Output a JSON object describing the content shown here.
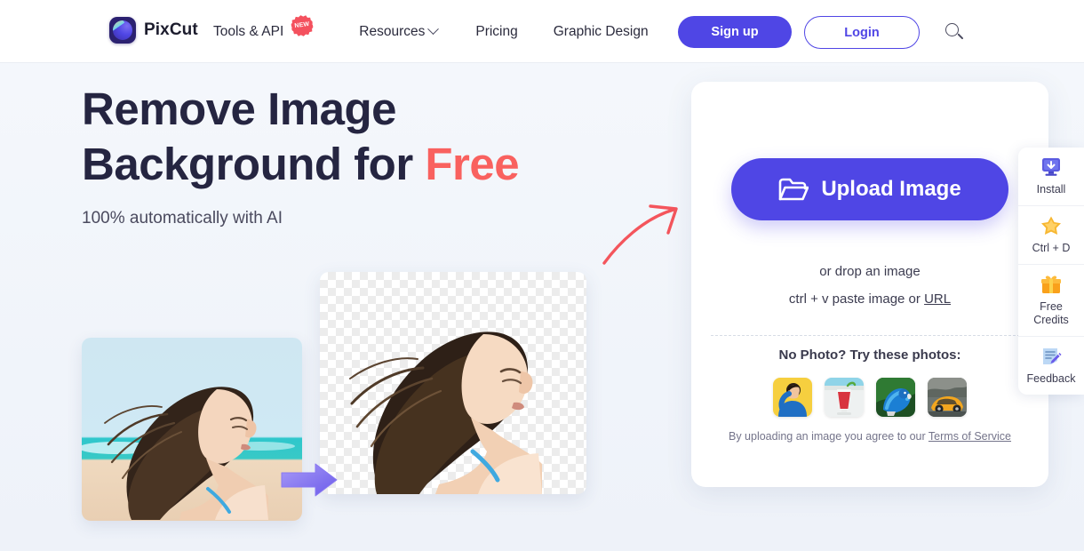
{
  "brand": {
    "name": "PixCut",
    "logo_icon": "pixcut-logo-icon"
  },
  "nav": {
    "items": [
      {
        "label": "Tools & API",
        "badge": "NEW",
        "has_caret": false
      },
      {
        "label": "Resources",
        "badge": "",
        "has_caret": true
      },
      {
        "label": "Pricing",
        "badge": "",
        "has_caret": false
      },
      {
        "label": "Graphic Design",
        "badge": "",
        "has_caret": false
      }
    ],
    "signup_label": "Sign up",
    "login_label": "Login",
    "search_icon": "search-icon"
  },
  "hero": {
    "line1": "Remove Image",
    "line2_pre": "Background for ",
    "line2_accent": "Free",
    "subtitle": "100% automatically with AI",
    "before_alt": "woman-on-beach-before",
    "after_alt": "woman-transparent-background-after",
    "transition_arrow_icon": "right-arrow-icon",
    "pointer_arrow_icon": "curved-arrow-icon"
  },
  "upload": {
    "button_label": "Upload Image",
    "button_icon": "folder-icon",
    "drop_text": "or drop an image",
    "paste_text": "ctrl + v paste image or ",
    "paste_link": "URL",
    "try_title": "No Photo? Try these photos:",
    "samples": [
      {
        "name": "sample-person-yellow"
      },
      {
        "name": "sample-drink"
      },
      {
        "name": "sample-parrot"
      },
      {
        "name": "sample-car"
      }
    ],
    "terms_text": "By uploading an image you agree to our ",
    "terms_link": "Terms of Service"
  },
  "rail": {
    "items": [
      {
        "label": "Install",
        "icon": "monitor-download-icon"
      },
      {
        "label": "Ctrl + D",
        "icon": "star-icon"
      },
      {
        "label": "Free\nCredits",
        "label_line1": "Free",
        "label_line2": "Credits",
        "icon": "gift-icon"
      },
      {
        "label": "Feedback",
        "icon": "note-pencil-icon"
      }
    ]
  },
  "colors": {
    "accent_purple": "#4f46e5",
    "accent_red": "#f9615f",
    "badge_red": "#f4515e",
    "heading": "#252541",
    "page_bg": "#f3f6fb",
    "card_bg": "#ffffff"
  }
}
